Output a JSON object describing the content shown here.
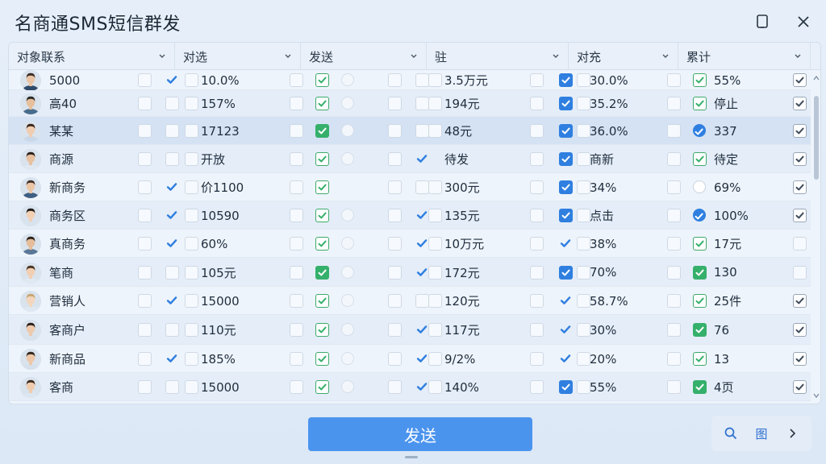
{
  "window": {
    "title": "名商通SMS短信群发",
    "restore_icon": "restore-icon",
    "close_icon": "close-icon"
  },
  "table": {
    "columns": [
      {
        "label": "对象联系"
      },
      {
        "label": "对选"
      },
      {
        "label": "发送"
      },
      {
        "label": "驻"
      },
      {
        "label": "对充"
      },
      {
        "label": "累计"
      }
    ],
    "rows": [
      {
        "name": "5000",
        "c2": "10.0%",
        "c4": "3.5万元",
        "c5": "30.0%",
        "c6": "55%"
      },
      {
        "name": "高40",
        "c2": "157%",
        "c4": "194元",
        "c5": "35.2%",
        "c6": "停止"
      },
      {
        "name": "某某",
        "c2": "17123",
        "c4": "48元",
        "c5": "36.0%",
        "c6": "337"
      },
      {
        "name": "商源",
        "c2": "开放",
        "c4": "待发",
        "c5": "商新",
        "c6": "待定"
      },
      {
        "name": "新商务",
        "c2": "价1100",
        "c4": "300元",
        "c5": "34%",
        "c6": "69%"
      },
      {
        "name": "商务区",
        "c2": "10590",
        "c4": "135元",
        "c5": "点击",
        "c6": "100%"
      },
      {
        "name": "真商务",
        "c2": "60%",
        "c4": "10万元",
        "c5": "38%",
        "c6": "17元"
      },
      {
        "name": "笔商",
        "c2": "105元",
        "c4": "172元",
        "c5": "70%",
        "c6": "130"
      },
      {
        "name": "营销人",
        "c2": "15000",
        "c4": "120元",
        "c5": "58.7%",
        "c6": "25件"
      },
      {
        "name": "客商户",
        "c2": "110元",
        "c4": "117元",
        "c5": "30%",
        "c6": "76"
      },
      {
        "name": "新商品",
        "c2": "185%",
        "c4": "9/2%",
        "c5": "20%",
        "c6": "13"
      },
      {
        "name": "客商",
        "c2": "15000",
        "c4": "140%",
        "c5": "55%",
        "c6": "4页"
      }
    ]
  },
  "footer": {
    "send_label": "发送",
    "search_icon": "search-icon",
    "image_label": "图",
    "next_icon": "chevron-right-icon"
  },
  "colors": {
    "accent": "#4b94ee",
    "check_green": "#35b06b",
    "check_blue": "#2f7fe0"
  }
}
